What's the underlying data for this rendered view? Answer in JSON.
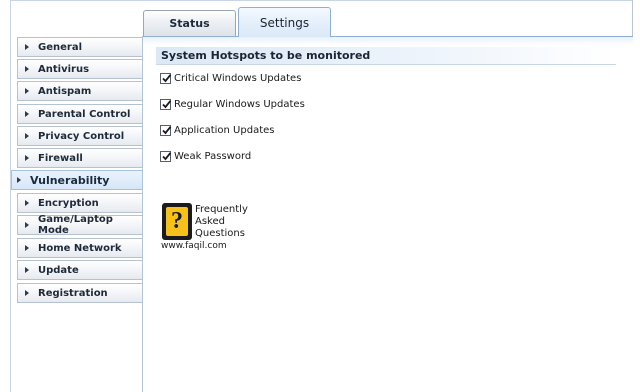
{
  "tabs": [
    {
      "label": "Status",
      "active": false
    },
    {
      "label": "Settings",
      "active": true
    }
  ],
  "sidebar": {
    "items": [
      {
        "label": "General"
      },
      {
        "label": "Antivirus"
      },
      {
        "label": "Antispam"
      },
      {
        "label": "Parental Control"
      },
      {
        "label": "Privacy Control"
      },
      {
        "label": "Firewall"
      },
      {
        "label": "Vulnerability",
        "active": true
      },
      {
        "label": "Encryption"
      },
      {
        "label": "Game/Laptop Mode"
      },
      {
        "label": "Home Network"
      },
      {
        "label": "Update"
      },
      {
        "label": "Registration"
      }
    ]
  },
  "section": {
    "title": "System Hotspots to be monitored",
    "checkboxes": [
      {
        "label": "Critical Windows Updates",
        "checked": true
      },
      {
        "label": "Regular Windows Updates",
        "checked": true
      },
      {
        "label": "Application Updates",
        "checked": true
      },
      {
        "label": "Weak Password",
        "checked": true
      }
    ]
  },
  "watermark": {
    "symbol": "?",
    "line1": "Frequently",
    "line2": "Asked",
    "line3": "Questions",
    "url": "www.faqil.com"
  },
  "colors": {
    "tab_active_bg": "#e2eefb",
    "sidebar_active_bg": "#d6e6f7",
    "logo_yellow": "#f6c21a",
    "logo_dark": "#1b1b1b"
  }
}
